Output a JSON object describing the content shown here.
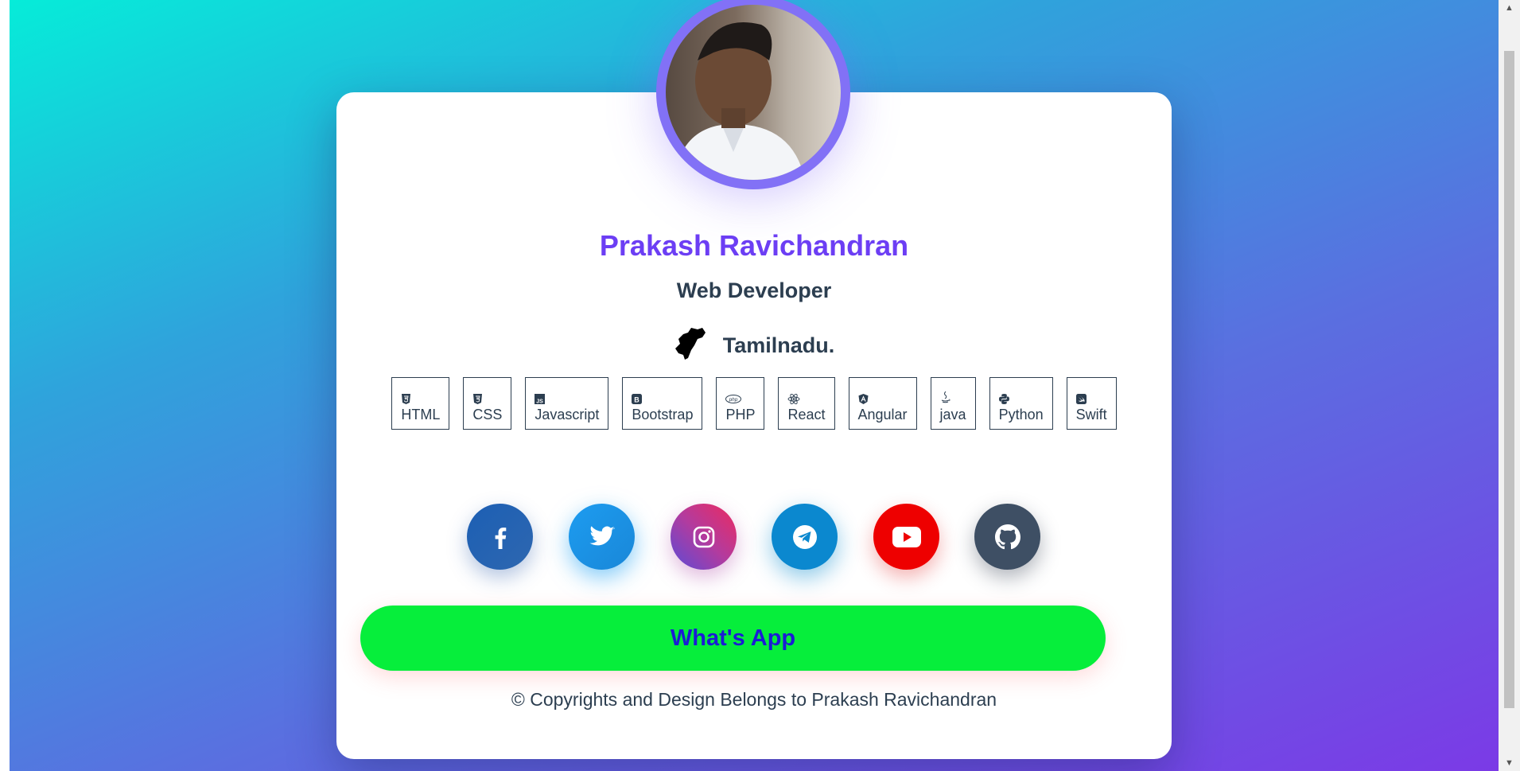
{
  "profile": {
    "name": "Prakash Ravichandran",
    "role": "Web Developer",
    "location": "Tamilnadu."
  },
  "skills": [
    {
      "label": "HTML",
      "icon": "html5-icon"
    },
    {
      "label": "CSS",
      "icon": "css3-icon"
    },
    {
      "label": "Javascript",
      "icon": "js-icon"
    },
    {
      "label": "Bootstrap",
      "icon": "bootstrap-icon"
    },
    {
      "label": "PHP",
      "icon": "php-icon"
    },
    {
      "label": "React",
      "icon": "react-icon"
    },
    {
      "label": "Angular",
      "icon": "angular-icon"
    },
    {
      "label": "java",
      "icon": "java-icon"
    },
    {
      "label": "Python",
      "icon": "python-icon"
    },
    {
      "label": "Swift",
      "icon": "swift-icon"
    }
  ],
  "socials": [
    {
      "icon": "facebook-icon",
      "color": "#2b63b0"
    },
    {
      "icon": "twitter-icon",
      "color": "#1da1f2"
    },
    {
      "icon": "instagram-icon",
      "color": "#c13584"
    },
    {
      "icon": "telegram-icon",
      "color": "#0088cc"
    },
    {
      "icon": "youtube-icon",
      "color": "#ee0000"
    },
    {
      "icon": "github-icon",
      "color": "#3d4e63"
    }
  ],
  "whatsapp_label": "What's App",
  "footer": "© Copyrights and Design Belongs to Prakash Ravichandran",
  "theme": {
    "accent": "#6c3ef4",
    "text": "#2c3e50",
    "whatsapp_bg": "#06ee3b",
    "whatsapp_text": "#1b1bd6"
  }
}
